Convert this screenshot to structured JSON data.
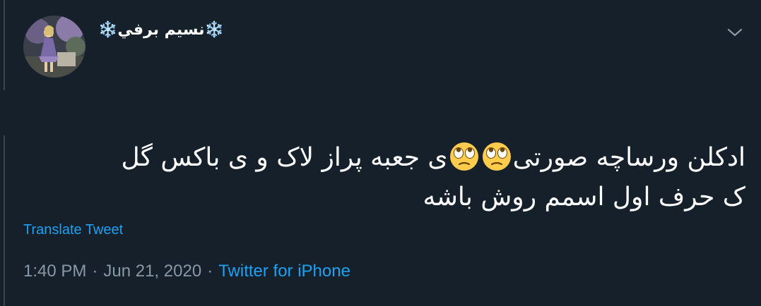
{
  "author": {
    "display_name_prefix": "❄️",
    "display_name": "نسیم برفي",
    "display_name_suffix": "❄️",
    "avatar_icon": "profile-photo"
  },
  "menu": {
    "icon": "chevron-down-icon"
  },
  "tweet": {
    "line1_part1": "ادکلن ورساچه صورتی",
    "line1_part2": "ی جعبه پراز لاک و ی باکس گل",
    "line2": "ک حرف اول اسمم روش باشه",
    "emoji": [
      "face-with-rolling-eyes-emoji",
      "face-with-rolling-eyes-emoji"
    ]
  },
  "translate_label": "Translate Tweet",
  "meta": {
    "time": "1:40 PM",
    "separator": "·",
    "date": "Jun 21, 2020",
    "source": "Twitter for iPhone"
  },
  "colors": {
    "background": "#15202b",
    "text": "#ffffff",
    "secondary_text": "#8899a6",
    "link": "#1da1f2",
    "thread_line": "#38444d"
  }
}
